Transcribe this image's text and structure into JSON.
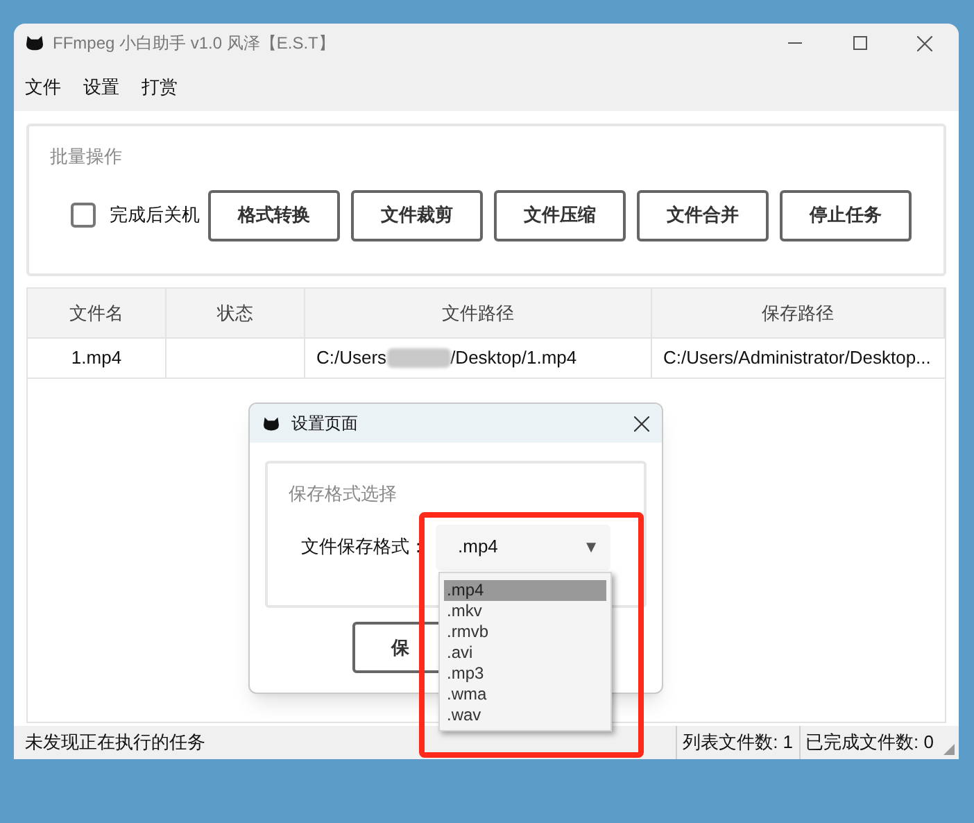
{
  "window": {
    "title": "FFmpeg 小白助手 v1.0 风泽【E.S.T】"
  },
  "menu": [
    "文件",
    "设置",
    "打赏"
  ],
  "batch_group": {
    "title": "批量操作",
    "shutdown_checkbox": {
      "label": "完成后关机",
      "checked": false
    },
    "buttons": [
      "格式转换",
      "文件裁剪",
      "文件压缩",
      "文件合并",
      "停止任务"
    ]
  },
  "table": {
    "columns": [
      "文件名",
      "状态",
      "文件路径",
      "保存路径"
    ],
    "rows": [
      {
        "file_name": "1.mp4",
        "path_start": "C:/Users",
        "path_redacted": true,
        "path_end": "/Desktop/1.mp4",
        "save_path": "C:/Users/Administrator/Desktop..."
      }
    ]
  },
  "status_bar": {
    "message": "未发现正在执行的任务",
    "file_count": "列表文件数: 1",
    "done_count": "已完成文件数: 0"
  },
  "dialog": {
    "title": "设置页面",
    "group_title": "保存格式选择",
    "label": "文件保存格式：",
    "combo_value": ".mp4",
    "combo_arrow": "▼",
    "button_label": "保",
    "options": [
      {
        "label": ".mp4",
        "selected": true
      },
      {
        "label": ".mkv",
        "selected": false
      },
      {
        "label": ".rmvb",
        "selected": false
      },
      {
        "label": ".avi",
        "selected": false
      },
      {
        "label": ".mp3",
        "selected": false
      },
      {
        "label": ".wma",
        "selected": false
      },
      {
        "label": ".wav",
        "selected": false
      }
    ]
  },
  "annotation": {
    "kind": "rectangle"
  }
}
